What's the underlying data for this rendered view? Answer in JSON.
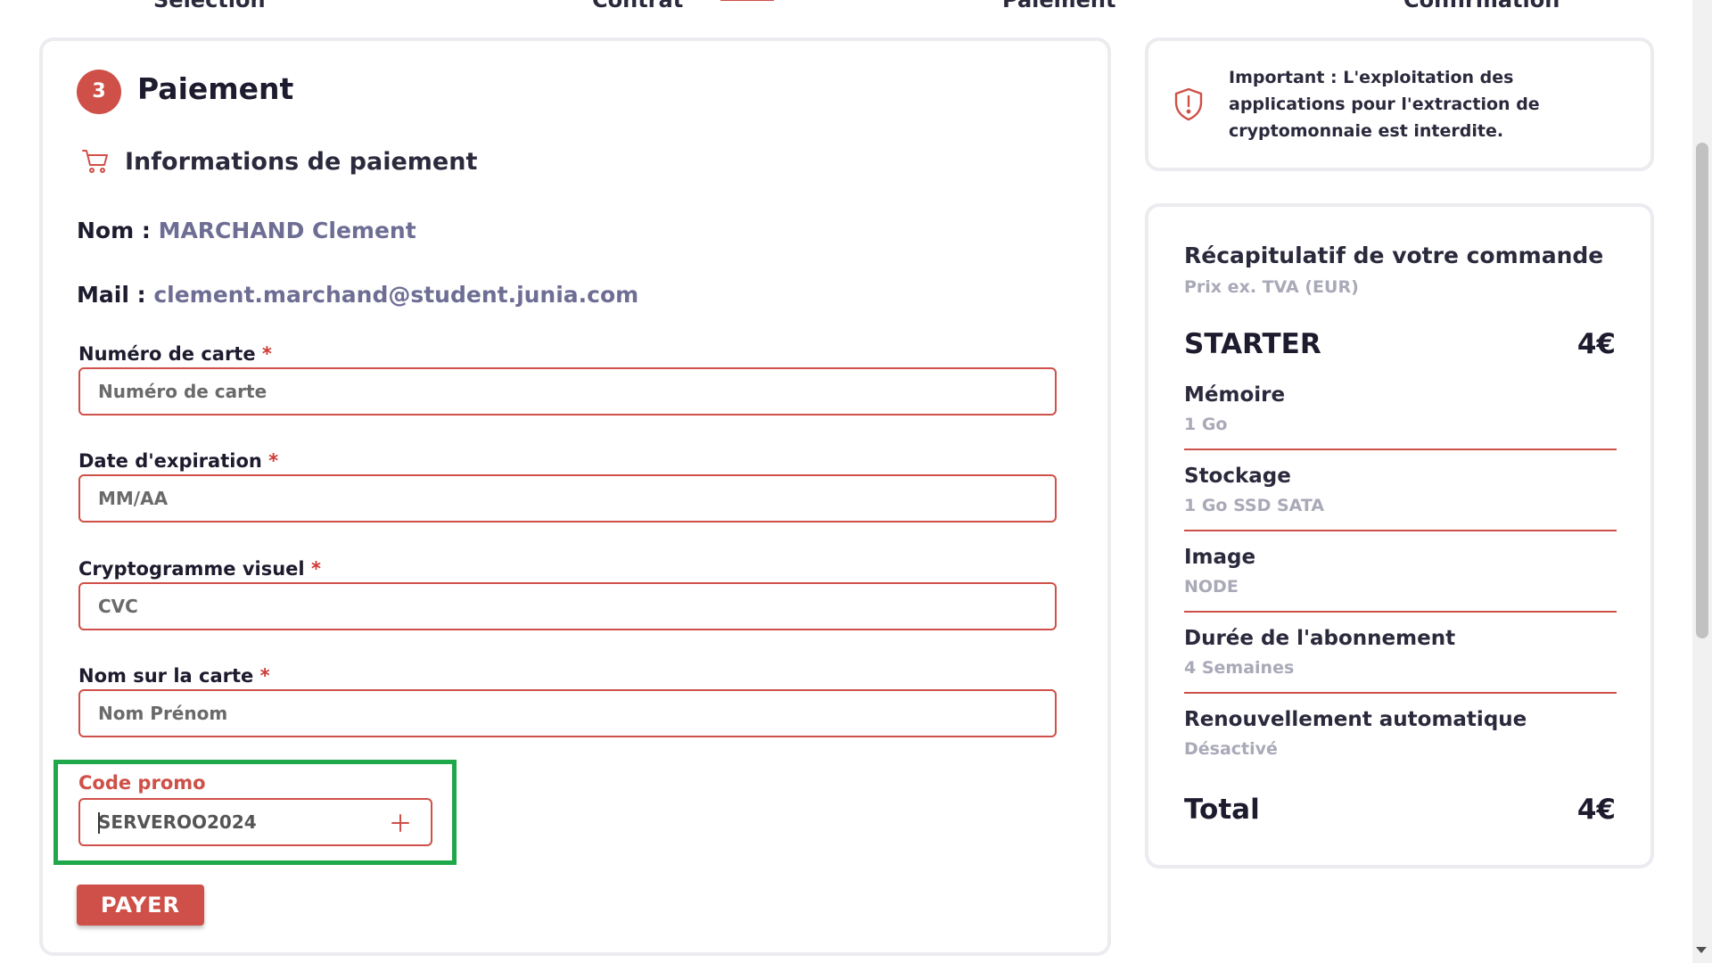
{
  "stepper": {
    "steps": [
      "Sélection",
      "Contrat",
      "Paiement",
      "Confirmation"
    ]
  },
  "payment": {
    "step_number": "3",
    "title": "Paiement",
    "section_icon": "shopping-cart-icon",
    "section_title": "Informations de paiement",
    "name_label": "Nom :",
    "name_value": "MARCHAND Clement",
    "mail_label": "Mail :",
    "mail_value": "clement.marchand@student.junia.com",
    "required_mark": "*",
    "fields": [
      {
        "label": "Numéro de carte",
        "placeholder": "Numéro de carte",
        "value": ""
      },
      {
        "label": "Date d'expiration",
        "placeholder": "MM/AA",
        "value": ""
      },
      {
        "label": "Cryptogramme visuel",
        "placeholder": "CVC",
        "value": ""
      },
      {
        "label": "Nom sur la carte",
        "placeholder": "Nom Prénom",
        "value": ""
      }
    ],
    "promo": {
      "label": "Code promo",
      "value": "SERVEROO2024",
      "add_icon": "plus-icon"
    },
    "pay_button": "PAYER"
  },
  "notice": {
    "icon": "shield-alert-icon",
    "text": "Important : L'exploitation des applications pour l'extraction de cryptomonnaie est interdite."
  },
  "summary": {
    "title": "Récapitulatif de votre commande",
    "subtitle": "Prix ex. TVA (EUR)",
    "plan": "STARTER",
    "plan_price": "4€",
    "rows": [
      {
        "title": "Mémoire",
        "value": "1 Go"
      },
      {
        "title": "Stockage",
        "value": "1 Go SSD SATA"
      },
      {
        "title": "Image",
        "value": "NODE"
      },
      {
        "title": "Durée de l'abonnement",
        "value": "4 Semaines"
      },
      {
        "title": "Renouvellement automatique",
        "value": "Désactivé"
      }
    ],
    "total_label": "Total",
    "total_value": "4€"
  },
  "colors": {
    "accent": "#cf5048",
    "highlight": "#1fa84a",
    "muted_value": "#6e6e95"
  }
}
